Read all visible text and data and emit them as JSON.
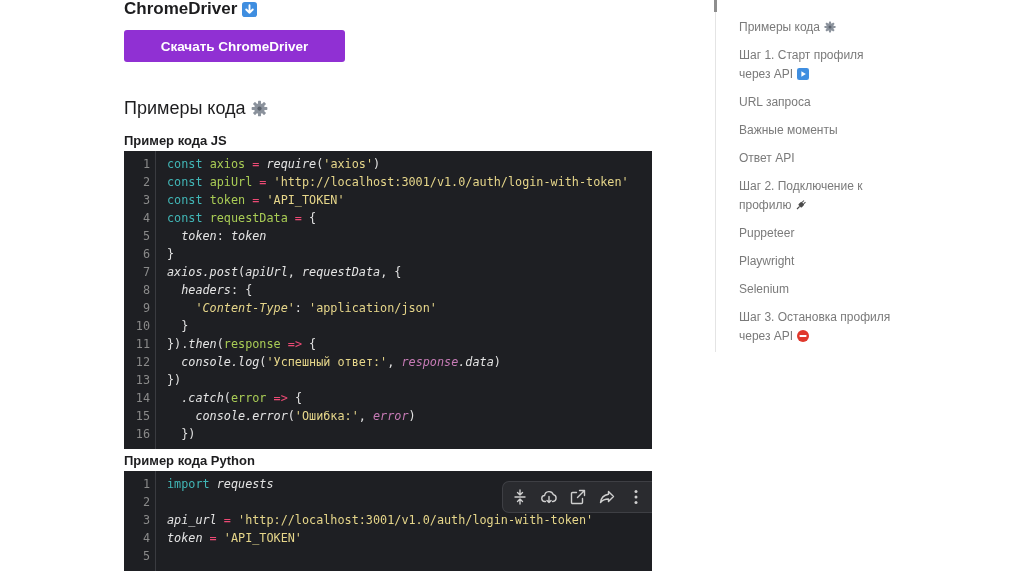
{
  "article": {
    "download": {
      "heading": {
        "text": "ChromeDriver",
        "kind": "down-arrow"
      },
      "button": "Скачать ChromeDriver"
    },
    "examples": {
      "heading": {
        "text": "Примеры кода",
        "kind": "gear"
      },
      "samples": [
        {
          "title": "Пример кода JS",
          "toolbar_visible": false,
          "lines": [
            {
              "number": "1",
              "tokens": [
                {
                  "text": "const ",
                  "kind": "keyword"
                },
                {
                  "text": "axios",
                  "kind": "name"
                },
                {
                  "text": " = ",
                  "kind": "operator"
                },
                {
                  "text": "require",
                  "kind": "call"
                },
                {
                  "text": "(",
                  "kind": "plain"
                },
                {
                  "text": "'axios'",
                  "kind": "string"
                },
                {
                  "text": ")",
                  "kind": "plain"
                }
              ]
            },
            {
              "number": "2",
              "tokens": [
                {
                  "text": "const ",
                  "kind": "keyword"
                },
                {
                  "text": "apiUrl",
                  "kind": "name"
                },
                {
                  "text": " = ",
                  "kind": "operator"
                },
                {
                  "text": "'http://localhost:3001/v1.0/auth/login-with-token'",
                  "kind": "string"
                }
              ]
            },
            {
              "number": "3",
              "tokens": [
                {
                  "text": "const ",
                  "kind": "keyword"
                },
                {
                  "text": "token",
                  "kind": "name"
                },
                {
                  "text": " = ",
                  "kind": "operator"
                },
                {
                  "text": "'API_TOKEN'",
                  "kind": "string"
                }
              ]
            },
            {
              "number": "4",
              "tokens": [
                {
                  "text": "const ",
                  "kind": "keyword"
                },
                {
                  "text": "requestData",
                  "kind": "name"
                },
                {
                  "text": " = ",
                  "kind": "operator"
                },
                {
                  "text": "{",
                  "kind": "plain"
                }
              ]
            },
            {
              "number": "5",
              "tokens": [
                {
                  "text": "  token",
                  "kind": "call"
                },
                {
                  "text": ": ",
                  "kind": "plain"
                },
                {
                  "text": "token",
                  "kind": "call"
                }
              ]
            },
            {
              "number": "6",
              "tokens": [
                {
                  "text": "}",
                  "kind": "plain"
                }
              ]
            },
            {
              "number": "7",
              "tokens": [
                {
                  "text": "axios.post",
                  "kind": "call"
                },
                {
                  "text": "(",
                  "kind": "plain"
                },
                {
                  "text": "apiUrl",
                  "kind": "call"
                },
                {
                  "text": ", ",
                  "kind": "plain"
                },
                {
                  "text": "requestData",
                  "kind": "call"
                },
                {
                  "text": ", {",
                  "kind": "plain"
                }
              ]
            },
            {
              "number": "8",
              "tokens": [
                {
                  "text": "  headers",
                  "kind": "call"
                },
                {
                  "text": ": {",
                  "kind": "plain"
                }
              ]
            },
            {
              "number": "9",
              "tokens": [
                {
                  "text": "    'Content-Type'",
                  "kind": "key"
                },
                {
                  "text": ": ",
                  "kind": "plain"
                },
                {
                  "text": "'application/json'",
                  "kind": "string"
                }
              ]
            },
            {
              "number": "10",
              "tokens": [
                {
                  "text": "  }",
                  "kind": "plain"
                }
              ]
            },
            {
              "number": "11",
              "tokens": [
                {
                  "text": "}).",
                  "kind": "plain"
                },
                {
                  "text": "then",
                  "kind": "call"
                },
                {
                  "text": "(",
                  "kind": "plain"
                },
                {
                  "text": "response",
                  "kind": "name"
                },
                {
                  "text": " => ",
                  "kind": "operator"
                },
                {
                  "text": "{",
                  "kind": "plain"
                }
              ]
            },
            {
              "number": "12",
              "tokens": [
                {
                  "text": "  console.log",
                  "kind": "call"
                },
                {
                  "text": "(",
                  "kind": "plain"
                },
                {
                  "text": "'Успешный ответ:'",
                  "kind": "string"
                },
                {
                  "text": ", ",
                  "kind": "plain"
                },
                {
                  "text": "response",
                  "kind": "param"
                },
                {
                  "text": ".data",
                  "kind": "call"
                },
                {
                  "text": ")",
                  "kind": "plain"
                }
              ]
            },
            {
              "number": "13",
              "tokens": [
                {
                  "text": "})",
                  "kind": "plain"
                }
              ]
            },
            {
              "number": "14",
              "tokens": [
                {
                  "text": "  .catch",
                  "kind": "call"
                },
                {
                  "text": "(",
                  "kind": "plain"
                },
                {
                  "text": "error",
                  "kind": "name"
                },
                {
                  "text": " => ",
                  "kind": "operator"
                },
                {
                  "text": "{",
                  "kind": "plain"
                }
              ]
            },
            {
              "number": "15",
              "tokens": [
                {
                  "text": "    console.error",
                  "kind": "call"
                },
                {
                  "text": "(",
                  "kind": "plain"
                },
                {
                  "text": "'Ошибка:'",
                  "kind": "string"
                },
                {
                  "text": ", ",
                  "kind": "plain"
                },
                {
                  "text": "error",
                  "kind": "param"
                },
                {
                  "text": ")",
                  "kind": "plain"
                }
              ]
            },
            {
              "number": "16",
              "tokens": [
                {
                  "text": "  })",
                  "kind": "plain"
                }
              ]
            }
          ]
        },
        {
          "title": "Пример кода Python",
          "toolbar_visible": true,
          "lines": [
            {
              "number": "1",
              "tokens": [
                {
                  "text": "import ",
                  "kind": "keyword"
                },
                {
                  "text": "requests",
                  "kind": "call"
                }
              ]
            },
            {
              "number": "2"
            },
            {
              "number": "3",
              "tokens": [
                {
                  "text": "api_url",
                  "kind": "call"
                },
                {
                  "text": " = ",
                  "kind": "operator"
                },
                {
                  "text": "'http://localhost:3001/v1.0/auth/login-with-token'",
                  "kind": "string"
                }
              ]
            },
            {
              "number": "4",
              "tokens": [
                {
                  "text": "token",
                  "kind": "call"
                },
                {
                  "text": " = ",
                  "kind": "operator"
                },
                {
                  "text": "'API_TOKEN'",
                  "kind": "string"
                }
              ]
            },
            {
              "number": "5"
            }
          ]
        }
      ]
    }
  },
  "toc": {
    "items": [
      {
        "label": "Примеры кода",
        "kind": "gear"
      },
      {
        "label": "Шаг 1. Старт профиля через API",
        "kind": "play"
      },
      {
        "label": "URL запроса",
        "kind": "text"
      },
      {
        "label": "Важные моменты",
        "kind": "text"
      },
      {
        "label": "Ответ API",
        "kind": "text"
      },
      {
        "label": "Шаг 2. Подключение к профилю",
        "kind": "plug"
      },
      {
        "label": "Puppeteer",
        "kind": "text"
      },
      {
        "label": "Playwright",
        "kind": "text"
      },
      {
        "label": "Selenium",
        "kind": "text"
      },
      {
        "label": "Шаг 3. Остановка профиля через API",
        "kind": "no-entry"
      }
    ]
  }
}
